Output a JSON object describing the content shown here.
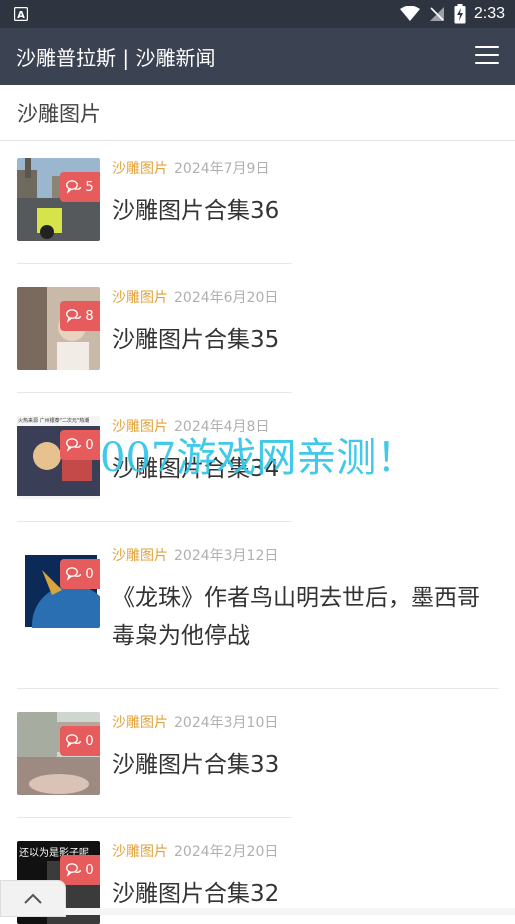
{
  "status_bar": {
    "time": "2:33"
  },
  "app_bar": {
    "title": "沙雕普拉斯 | 沙雕新闻"
  },
  "section": {
    "title": "沙雕图片"
  },
  "articles": [
    {
      "category": "沙雕图片",
      "date": "2024年7月9日",
      "title": "沙雕图片合集36",
      "comments": "5"
    },
    {
      "category": "沙雕图片",
      "date": "2024年6月20日",
      "title": "沙雕图片合集35",
      "comments": "8"
    },
    {
      "category": "沙雕图片",
      "date": "2024年4月8日",
      "title": "沙雕图片合集34",
      "comments": "0"
    },
    {
      "category": "沙雕图片",
      "date": "2024年3月12日",
      "title": "《龙珠》作者鸟山明去世后，墨西哥毒枭为他停战",
      "comments": "0"
    },
    {
      "category": "沙雕图片",
      "date": "2024年3月10日",
      "title": "沙雕图片合集33",
      "comments": "0"
    },
    {
      "category": "沙雕图片",
      "date": "2024年2月20日",
      "title": "沙雕图片合集32",
      "comments": "0"
    }
  ],
  "thumb_text": {
    "item3": "火热来源 广州银泰\"二次元\"热潮",
    "item6": "还以为是影子呢"
  },
  "watermark": "007游戏网亲测！"
}
